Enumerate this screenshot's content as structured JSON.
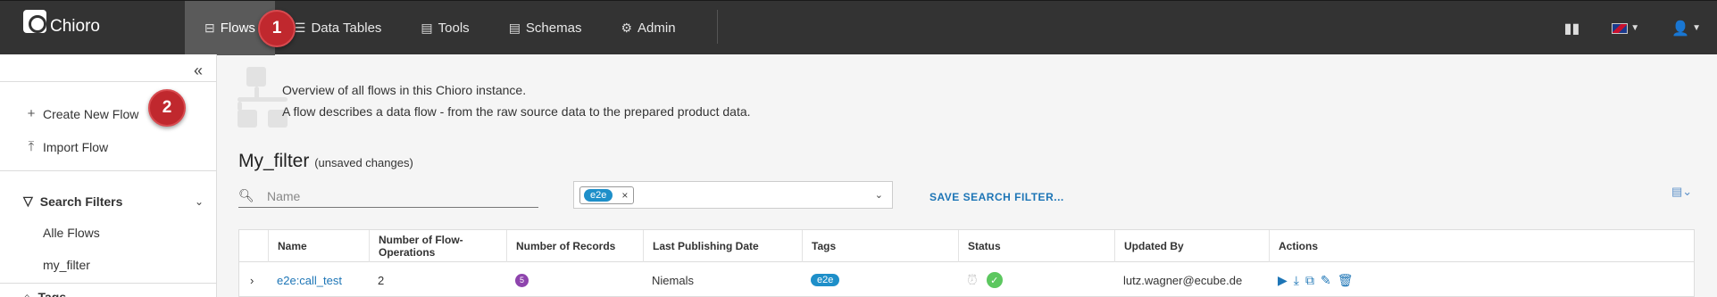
{
  "app": {
    "name": "Chioro"
  },
  "nav": {
    "items": [
      {
        "label": "Flows",
        "icon": "flows-icon"
      },
      {
        "label": "Data Tables",
        "icon": "list-icon"
      },
      {
        "label": "Tools",
        "icon": "tools-icon"
      },
      {
        "label": "Schemas",
        "icon": "schemas-icon"
      },
      {
        "label": "Admin",
        "icon": "gear-icon"
      }
    ],
    "right": [
      "book-icon",
      "flag-uk-icon",
      "user-icon"
    ]
  },
  "callouts": {
    "one": "1",
    "two": "2"
  },
  "sidebar": {
    "actions": [
      {
        "label": "Create New Flow",
        "icon": "plus-icon"
      },
      {
        "label": "Import Flow",
        "icon": "upload-icon"
      }
    ],
    "sections": [
      {
        "label": "Search Filters",
        "icon": "funnel-icon",
        "filters": [
          "Alle Flows",
          "my_filter"
        ]
      },
      {
        "label": "Tags",
        "icon": "tag-icon"
      }
    ]
  },
  "main": {
    "description": [
      "Overview of all flows in this Chioro instance.",
      "A flow describes a data flow - from the raw source data to the prepared product data."
    ],
    "filter_name": "My_filter",
    "filter_note": "(unsaved changes)",
    "search_placeholder": "Name",
    "selected_tag": "e2e",
    "save_filter_label": "SAVE SEARCH FILTER..."
  },
  "table": {
    "columns": [
      "Name",
      "Number of Flow-Operations",
      "Number of Records",
      "Last Publishing Date",
      "Tags",
      "Status",
      "Updated By",
      "Actions"
    ],
    "rows": [
      {
        "name": "e2e:call_test",
        "operations": "2",
        "records": "5",
        "last_published": "Niemals",
        "tag": "e2e",
        "status": [
          "alarm-icon",
          "check-icon"
        ],
        "updated_by": "lutz.wagner@ecube.de",
        "actions": [
          "play-icon",
          "download-icon",
          "copy-icon",
          "edit-icon",
          "trash-icon"
        ]
      }
    ]
  },
  "colors": {
    "topbar": "#333333",
    "accent": "#1d75b6",
    "callout": "#c0282e",
    "tag": "#1e8fc9",
    "records_badge": "#8e44ad",
    "status_ok": "#5cc75f"
  }
}
